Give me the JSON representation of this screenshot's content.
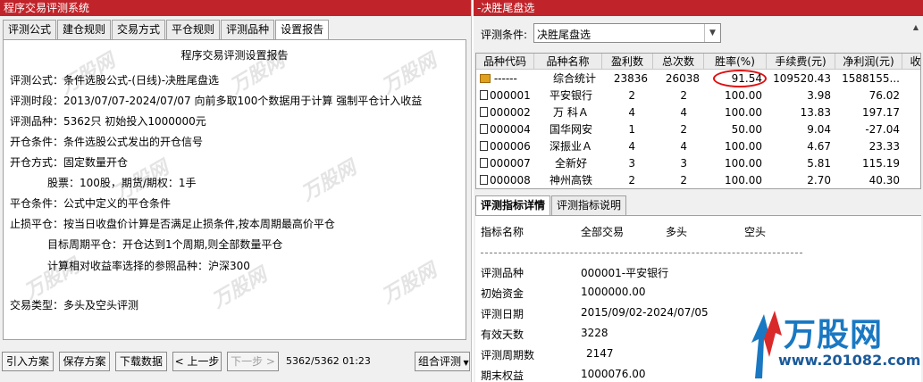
{
  "left": {
    "title": "程序交易评测系统",
    "tabs": [
      "评测公式",
      "建仓规则",
      "交易方式",
      "平仓规则",
      "评测品种",
      "设置报告"
    ],
    "active_tab": 5,
    "report": {
      "title": "程序交易评测设置报告",
      "lines": [
        "评测公式：条件选股公式-(日线)-决胜尾盘选",
        "评测时段：2013/07/07-2024/07/07 向前多取100个数据用于计算 强制平仓计入收益",
        "评测品种：5362只 初始投入1000000元",
        "开仓条件：条件选股公式发出的开仓信号",
        "开仓方式：固定数量开仓",
        "           股票：100股，期货/期权：1手",
        "平仓条件：公式中定义的平仓条件",
        "止损平仓：按当日收盘价计算是否满足止损条件,按本周期最高价平仓",
        "           目标周期平仓：开仓达到1个周期,则全部数量平仓",
        "           计算相对收益率选择的参照品种：沪深300",
        "交易类型：多头及空头评测"
      ]
    },
    "buttons": {
      "import": "引入方案",
      "save": "保存方案",
      "download": "下载数据",
      "prev": "< 上一步",
      "next": "下一步 >",
      "combo": "组合评测"
    },
    "status": "5362/5362 01:23",
    "watermark": "万股网"
  },
  "right": {
    "title": "-决胜尾盘选",
    "condition_label": "评测条件:",
    "condition_value": "决胜尾盘选",
    "grid": {
      "headers": [
        "品种代码",
        "品种名称",
        "盈利数",
        "总次数",
        "胜率(%)",
        "手续费(元)",
        "净利润(元)",
        "收"
      ],
      "rows": [
        {
          "code": "------",
          "name": "综合统计",
          "wins": "23836",
          "total": "26038",
          "rate": "91.54",
          "fee": "109520.43",
          "profit": "1588155..."
        },
        {
          "code": "000001",
          "name": "平安银行",
          "wins": "2",
          "total": "2",
          "rate": "100.00",
          "fee": "3.98",
          "profit": "76.02"
        },
        {
          "code": "000002",
          "name": "万 科Ａ",
          "wins": "4",
          "total": "4",
          "rate": "100.00",
          "fee": "13.83",
          "profit": "197.17"
        },
        {
          "code": "000004",
          "name": "国华网安",
          "wins": "1",
          "total": "2",
          "rate": "50.00",
          "fee": "9.04",
          "profit": "-27.04"
        },
        {
          "code": "000006",
          "name": "深振业Ａ",
          "wins": "4",
          "total": "4",
          "rate": "100.00",
          "fee": "4.67",
          "profit": "23.33"
        },
        {
          "code": "000007",
          "name": "全新好",
          "wins": "3",
          "total": "3",
          "rate": "100.00",
          "fee": "5.81",
          "profit": "115.19"
        },
        {
          "code": "000008",
          "name": "神州高铁",
          "wins": "2",
          "total": "2",
          "rate": "100.00",
          "fee": "2.70",
          "profit": "40.30"
        }
      ]
    },
    "tabs": [
      "评测指标详情",
      "评测指标说明"
    ],
    "detail": {
      "headers": [
        "指标名称",
        "全部交易",
        "多头",
        "空头"
      ],
      "rows": [
        {
          "label": "评测品种",
          "value": "000001-平安银行"
        },
        {
          "label": "初始资金",
          "value": "1000000.00"
        },
        {
          "label": "评测日期",
          "value": "2015/09/02-2024/07/05"
        },
        {
          "label": "有效天数",
          "value": "3228"
        },
        {
          "label": "评测周期数",
          "value": "2147"
        },
        {
          "label": "期末权益",
          "value": "1000076.00"
        }
      ]
    },
    "logo": {
      "text": "万股网",
      "url": "www.201082.com"
    }
  },
  "colors": {
    "titlebar": "#c0242a",
    "highlight_circle": "#e01010",
    "logo": "#1a78c2"
  }
}
